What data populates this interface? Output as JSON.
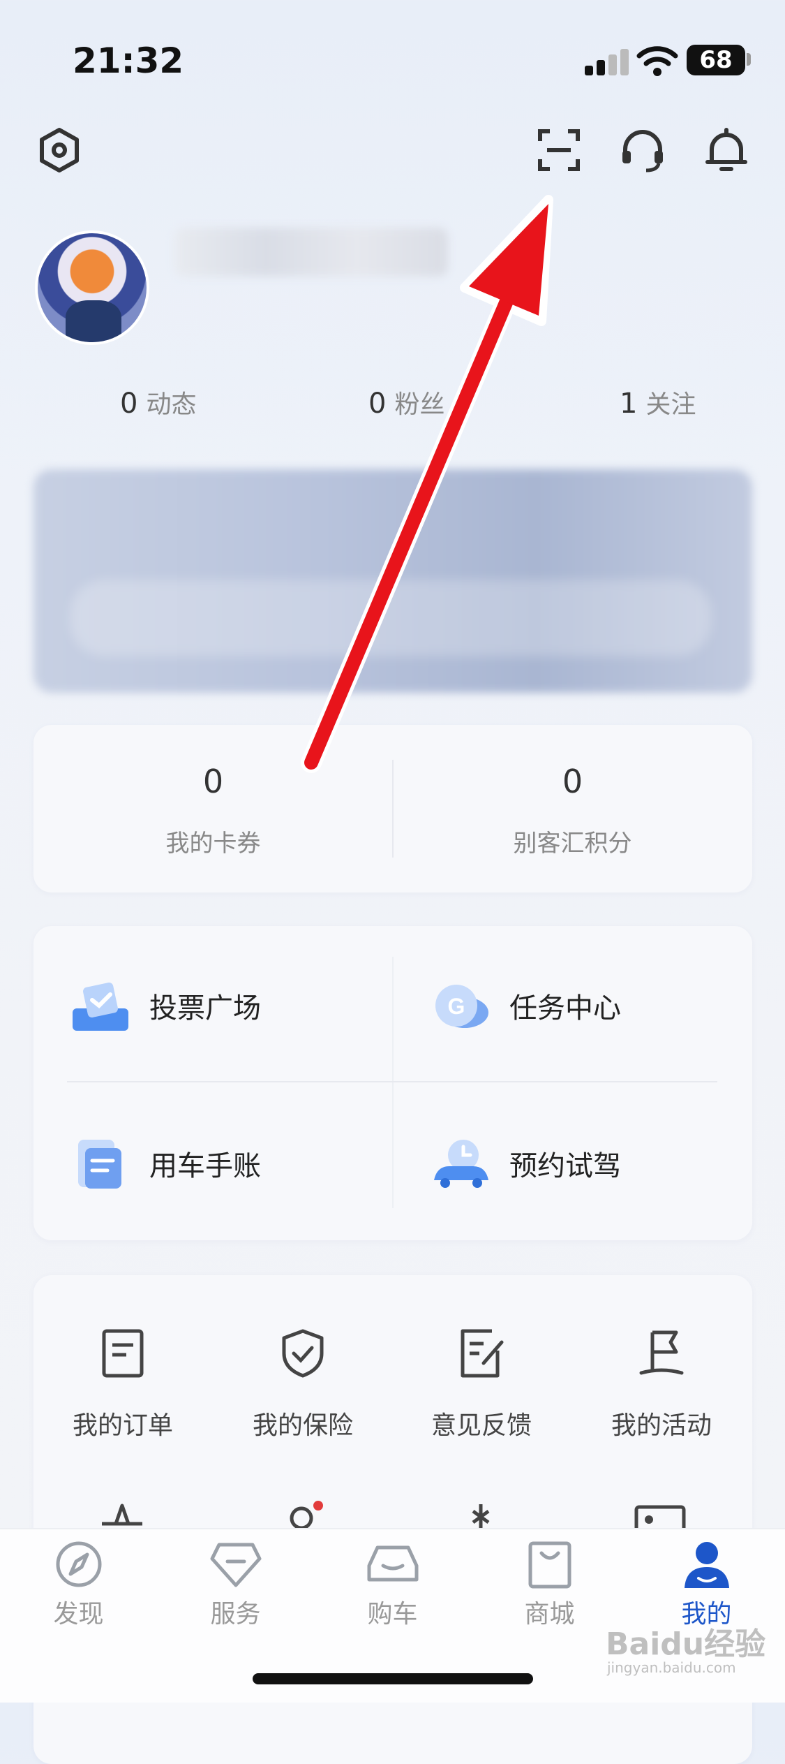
{
  "status_bar": {
    "time": "21:32",
    "battery": "68"
  },
  "profile": {
    "stats": [
      {
        "num": "0",
        "label": "动态"
      },
      {
        "num": "0",
        "label": "粉丝"
      },
      {
        "num": "1",
        "label": "关注"
      }
    ]
  },
  "points": [
    {
      "num": "0",
      "label": "我的卡券"
    },
    {
      "num": "0",
      "label": "别客汇积分"
    }
  ],
  "features": [
    {
      "label": "投票广场",
      "icon": "vote-icon"
    },
    {
      "label": "任务中心",
      "icon": "task-icon"
    },
    {
      "label": "用车手账",
      "icon": "notebook-icon"
    },
    {
      "label": "预约试驾",
      "icon": "test-drive-icon"
    }
  ],
  "services": [
    {
      "label": "我的订单",
      "icon": "order-icon"
    },
    {
      "label": "我的保险",
      "icon": "insurance-icon"
    },
    {
      "label": "意见反馈",
      "icon": "feedback-icon"
    },
    {
      "label": "我的活动",
      "icon": "activity-flag-icon"
    }
  ],
  "tabs": [
    {
      "label": "发现",
      "icon": "compass-icon",
      "active": false
    },
    {
      "label": "服务",
      "icon": "diamond-icon",
      "active": false
    },
    {
      "label": "购车",
      "icon": "car-icon",
      "active": false
    },
    {
      "label": "商城",
      "icon": "shopping-bag-icon",
      "active": false
    },
    {
      "label": "我的",
      "icon": "person-icon",
      "active": true
    }
  ],
  "watermark": {
    "brand": "Baidu经验",
    "url": "jingyan.baidu.com"
  },
  "colors": {
    "accent": "#1d56c9",
    "arrow": "#e8141b",
    "notification_dot": "#e23b3b"
  }
}
